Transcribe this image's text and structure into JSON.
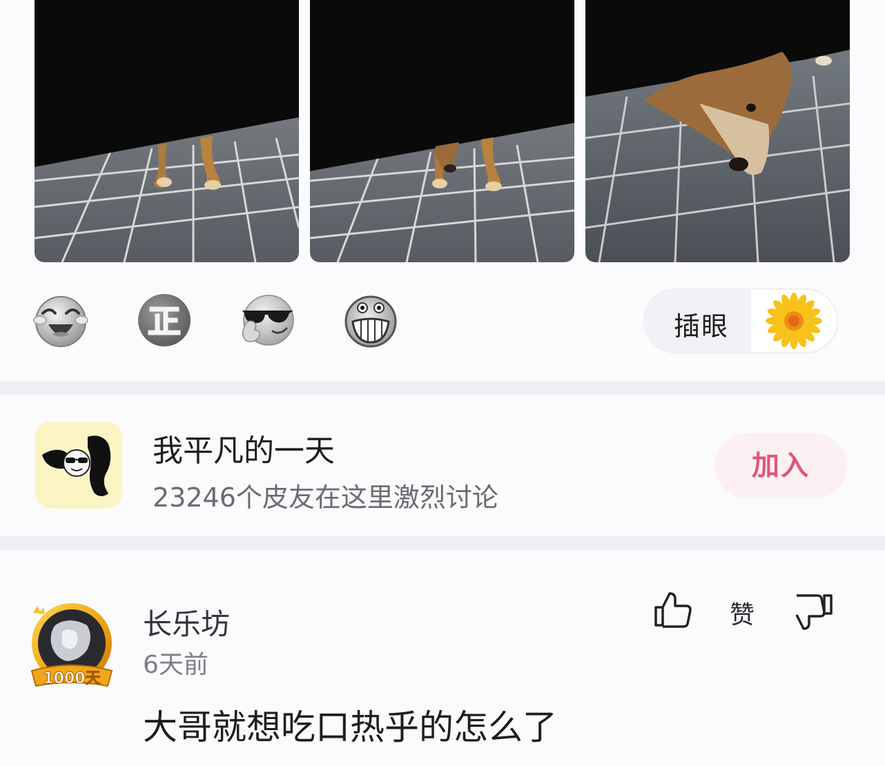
{
  "post": {
    "photos": [
      {
        "alt": "dog-feet-under-curtain-1"
      },
      {
        "alt": "dog-feet-under-curtain-2"
      },
      {
        "alt": "dog-head-under-curtain"
      }
    ],
    "reactions": [
      {
        "icon": "laughing-tears-icon"
      },
      {
        "icon": "zheng-icon"
      },
      {
        "icon": "sunglasses-icon"
      },
      {
        "icon": "grin-icon"
      }
    ],
    "poke_label": "插眼"
  },
  "community": {
    "name": "我平凡的一天",
    "meta": "23246个皮友在这里激烈讨论",
    "join_label": "加入",
    "accent": "#e0567a"
  },
  "comment": {
    "username": "长乐坊",
    "badge": "1000天",
    "time": "6天前",
    "text": "大哥就想吃口热乎的怎么了",
    "like_label": "赞"
  }
}
